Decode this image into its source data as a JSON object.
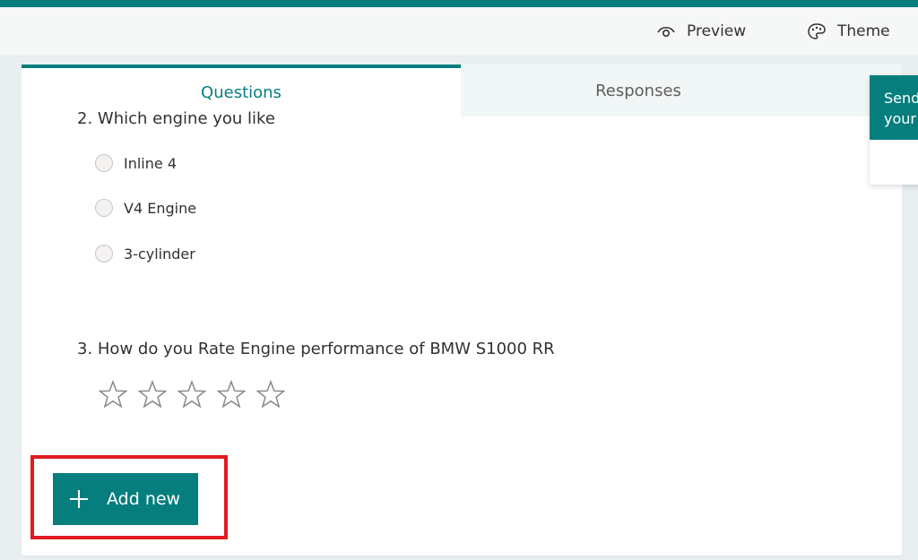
{
  "toolbar": {
    "preview_label": "Preview",
    "theme_label": "Theme"
  },
  "tabs": {
    "questions": "Questions",
    "responses": "Responses"
  },
  "questions": [
    {
      "title": "2. Which engine you like",
      "options": [
        "Inline 4",
        "V4 Engine",
        "3-cylinder"
      ]
    },
    {
      "title": "3. How do you Rate Engine performance of BMW S1000 RR",
      "rating_max": 5
    }
  ],
  "add_new_label": "Add new",
  "send_panel": {
    "line1": "Send",
    "line2": "your"
  },
  "colors": {
    "accent": "#077e7e",
    "highlight": "#e01b22"
  },
  "icons": [
    "eye-icon",
    "palette-icon",
    "star-icon",
    "plus-icon"
  ]
}
